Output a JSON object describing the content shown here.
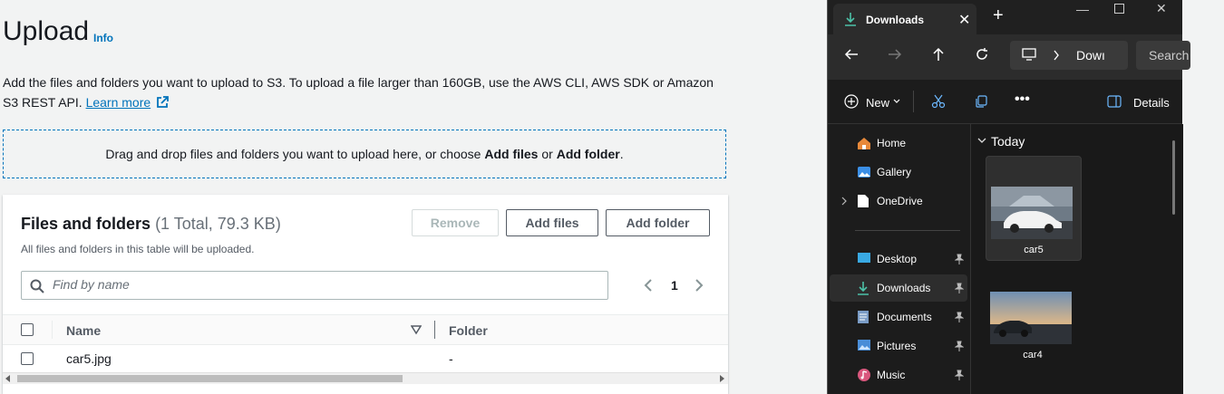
{
  "upload": {
    "title": "Upload",
    "info_link": "Info",
    "description": "Add the files and folders you want to upload to S3. To upload a file larger than 160GB, use the AWS CLI, AWS SDK or Amazon S3 REST API.",
    "learn_more": "Learn more",
    "dropzone_prefix": "Drag and drop files and folders you want to upload here, or choose ",
    "dropzone_add_files": "Add files",
    "dropzone_or": " or ",
    "dropzone_add_folder": "Add folder",
    "dropzone_suffix": "."
  },
  "files_panel": {
    "title": "Files and folders",
    "count": "(1 Total, 79.3 KB)",
    "subtitle": "All files and folders in this table will be uploaded.",
    "remove_label": "Remove",
    "add_files_label": "Add files",
    "add_folder_label": "Add folder",
    "search_placeholder": "Find by name",
    "page_number": "1",
    "columns": [
      "Name",
      "Folder"
    ],
    "rows": [
      {
        "name": "car5.jpg",
        "folder": "-"
      }
    ]
  },
  "explorer": {
    "tab_label": "Downloads",
    "address_text": "Dowı",
    "search_text": "Search",
    "new_label": "New",
    "details_label": "Details",
    "nav_items": [
      {
        "label": "Home",
        "icon": "home-icon"
      },
      {
        "label": "Gallery",
        "icon": "gallery-icon"
      },
      {
        "label": "OneDrive",
        "icon": "onedrive-icon"
      },
      {
        "label": "Desktop",
        "icon": "desktop-icon"
      },
      {
        "label": "Downloads",
        "icon": "downloads-icon"
      },
      {
        "label": "Documents",
        "icon": "documents-icon"
      },
      {
        "label": "Pictures",
        "icon": "pictures-icon"
      },
      {
        "label": "Music",
        "icon": "music-icon"
      }
    ],
    "group_label": "Today",
    "files": [
      {
        "name": "car5"
      },
      {
        "name": "car4"
      }
    ]
  },
  "colors": {
    "aws_link": "#0073bb",
    "explorer_bg": "#1c1c1c",
    "downloads_accent": "#4cc2a8"
  }
}
